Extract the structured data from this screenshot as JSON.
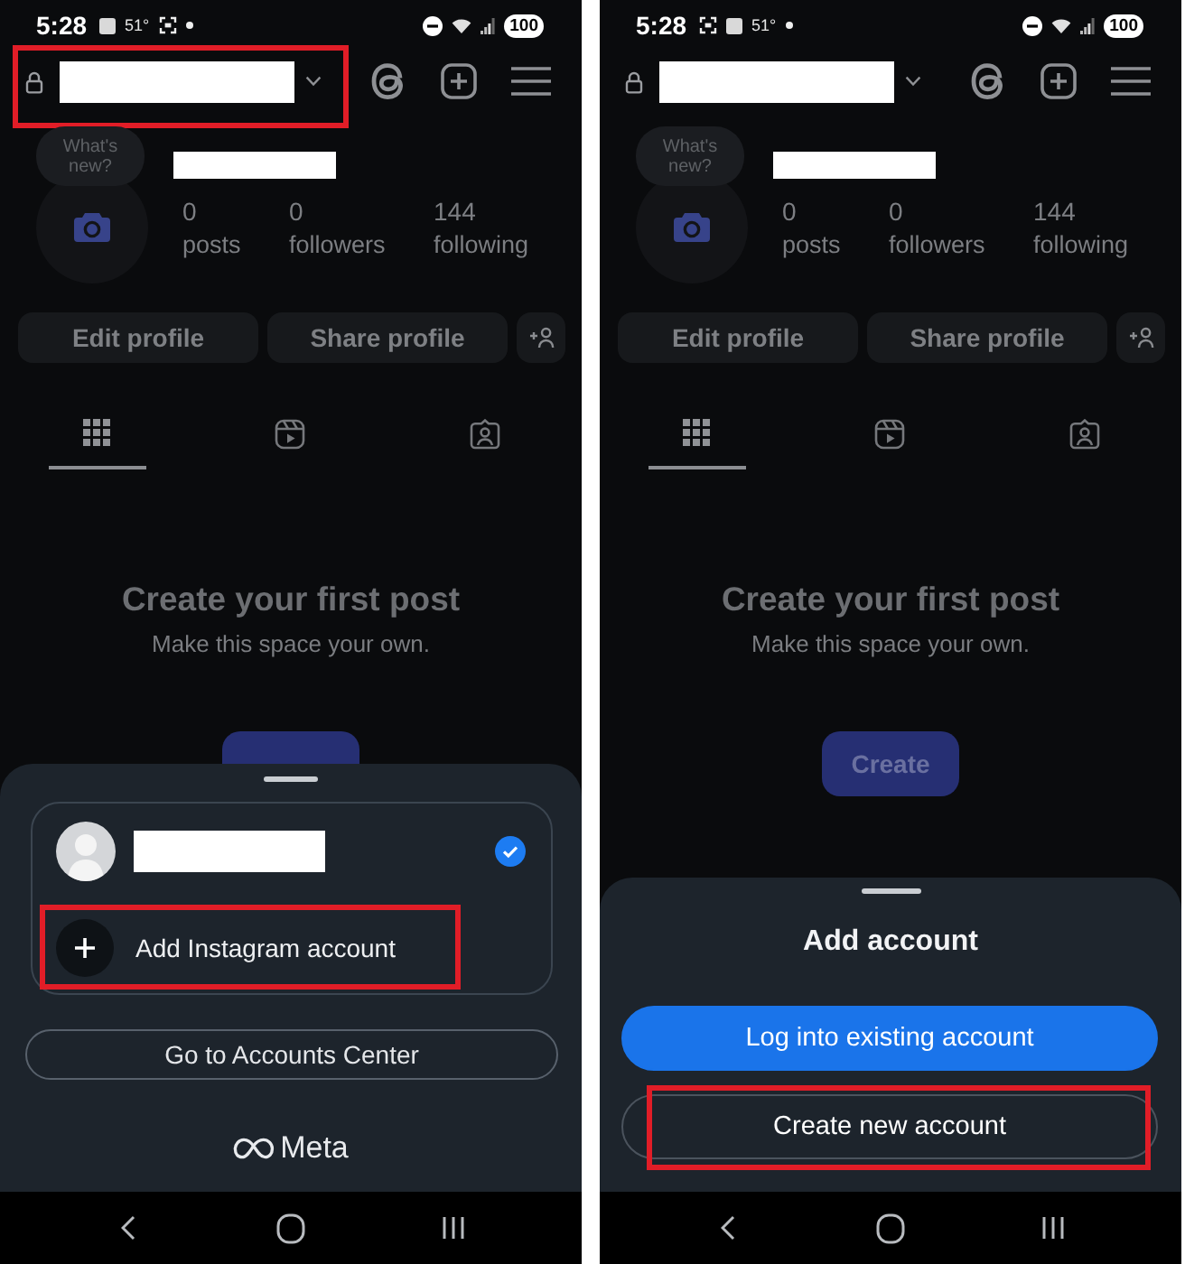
{
  "screens": [
    {
      "status_bar": {
        "time": "5:28",
        "indicators": [
          {
            "kind": "app"
          },
          {
            "kind": "temperature",
            "text": "51°"
          },
          {
            "kind": "screenshot"
          },
          {
            "kind": "dot"
          }
        ],
        "battery": "100"
      },
      "header": {
        "account_switcher": {
          "highlighted": true
        }
      },
      "profile": {
        "whats_new": "What's new?",
        "stats": [
          {
            "value": "0",
            "label": "posts"
          },
          {
            "value": "0",
            "label": "followers"
          },
          {
            "value": "144",
            "label": "following"
          }
        ],
        "buttons": [
          "Edit profile",
          "Share profile"
        ]
      },
      "tabs": [
        {
          "kind": "grid",
          "selected": true
        },
        {
          "kind": "reels",
          "selected": false
        },
        {
          "kind": "tagged",
          "selected": false
        }
      ],
      "empty_state": {
        "title": "Create your first post",
        "subtitle": "Make this space your own."
      },
      "sheet": {
        "kind": "account_switcher",
        "accounts": [
          {
            "selected": true
          }
        ],
        "add_account": {
          "label": "Add Instagram account",
          "highlighted": true
        },
        "accounts_center_button": "Go to Accounts Center",
        "brand": "Meta"
      }
    },
    {
      "status_bar": {
        "time": "5:28",
        "indicators": [
          {
            "kind": "screenshot"
          },
          {
            "kind": "app"
          },
          {
            "kind": "temperature",
            "text": "51°"
          },
          {
            "kind": "dot"
          }
        ],
        "battery": "100"
      },
      "header": {
        "account_switcher": {
          "highlighted": false
        }
      },
      "profile": {
        "whats_new": "What's new?",
        "stats": [
          {
            "value": "0",
            "label": "posts"
          },
          {
            "value": "0",
            "label": "followers"
          },
          {
            "value": "144",
            "label": "following"
          }
        ],
        "buttons": [
          "Edit profile",
          "Share profile"
        ]
      },
      "tabs": [
        {
          "kind": "grid",
          "selected": true
        },
        {
          "kind": "reels",
          "selected": false
        },
        {
          "kind": "tagged",
          "selected": false
        }
      ],
      "empty_state": {
        "title": "Create your first post",
        "subtitle": "Make this space your own.",
        "button": "Create"
      },
      "sheet": {
        "kind": "add_account",
        "title": "Add account",
        "buttons": [
          {
            "kind": "primary",
            "label": "Log into existing account",
            "highlighted": false
          },
          {
            "kind": "secondary",
            "label": "Create new account",
            "highlighted": true
          }
        ]
      }
    }
  ]
}
